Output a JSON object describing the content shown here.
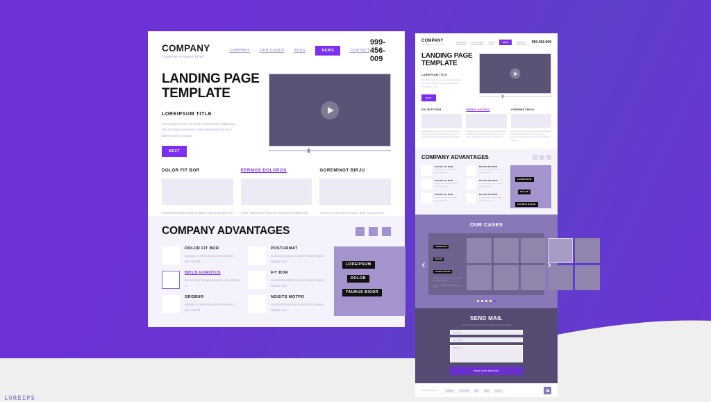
{
  "background": {
    "gradient_from": "#7030d8",
    "gradient_to": "#5f3ec9",
    "wave_color": "#efefef",
    "corner_text": "LOREIPS"
  },
  "brand": {
    "name": "COMPANY",
    "tagline": "TOURISM IPSUMUS FORS",
    "phone": "999-456-009"
  },
  "nav": {
    "items": [
      {
        "label": "COMPANY",
        "active": false
      },
      {
        "label": "OUR CASES",
        "active": false
      },
      {
        "label": "BLOG",
        "active": false
      },
      {
        "label": "NEWS",
        "active": true
      },
      {
        "label": "CONTACT",
        "active": false
      }
    ]
  },
  "hero": {
    "title": "LANDING PAGE TEMPLATE",
    "subtitle": "LOREIPSUM TITLE",
    "body": "Lorem ipsum dolor sit amet, consectetuer adipiscing elit, sed diam nonummy nibh euismod tincidunt ut laoreet dolore magna",
    "button": "NEXT",
    "video": {
      "play_icon": "play-icon",
      "progress_percent": 32
    }
  },
  "columns": [
    {
      "title": "DOLOR FIT BOR",
      "is_link": false,
      "text": "euismod tincidunt ut laoreet dolore magna aliquam erat volutpat. Ut wisi enim ad minim veniam, quis nostrud exerci tation ullamcorper suscipit lobortis nisl ut aliquip"
    },
    {
      "title": "PERMOS DOLOROS",
      "is_link": true,
      "text": "Lorem ipsum dolor sit amet, consectetuer adipiscing elit, sed diam nonummy nibh euismod tincidunt ut laoreet dolore magna aliquam erat volutpat. Ut wisi enim ad"
    },
    {
      "title": "GOREMINOT BIRJU",
      "is_link": false,
      "text": "Ut wisi enim ad minim veniam, quis nostrud exerci tation ullamcorper suscipit lobortis nisl ut aliquip ex ea commodo consequat. Duis autem vel eum iriure dolor in hendrerit"
    }
  ],
  "advantages": {
    "title": "COMPANY ADVANTAGES",
    "squares": 3,
    "left_items": [
      {
        "title": "DOLOR FIT BOR",
        "is_link": false,
        "text": "volutpat. Ut wisi enim ad minim veniam, quis nostrud"
      },
      {
        "title": "BITUS GOROTUS",
        "is_link": true,
        "text": "laoreet dolore magna aliquam erat volutpat. Ut"
      },
      {
        "title": "GROBUR",
        "is_link": false,
        "text": "volutpat. Ut wisi enim ad minim veniam, quis nostrud"
      }
    ],
    "right_items": [
      {
        "title": "POSTURMAT",
        "is_link": false,
        "text": "euismod tincidunt ut laoreet dolore magna aliquam erat"
      },
      {
        "title": "FIT BOR",
        "is_link": false,
        "text": "euismod tincidunt ut laoreet dolore magna aliquam erat"
      },
      {
        "title": "NOGITS MOTPO",
        "is_link": false,
        "text": "euismod tincidunt ut laoreet dolore magna aliquam erat"
      }
    ],
    "promo": {
      "line1": "LOREIPSUM",
      "line2": "DOLOR",
      "line3": "TAURUS BIGOR"
    }
  },
  "preview": {
    "advantage_item_title": "DOLOR FIT BOR",
    "advantage_item_text": "euismod tincidunt ut laoreet dolore magna aliquam erat",
    "cases": {
      "title": "OUR CASES",
      "prev_icon": "chevron-left-icon",
      "next_icon": "chevron-right-icon",
      "info": {
        "line1": "LOREIPSUM",
        "line2": "DOLOR",
        "line3": "TAURUS BIGOR"
      },
      "info_text1": "sed diam nonummy nibh euismod tincidunt ut laoreet dolore magna",
      "info_text2": "aliquam erat volutpat. Ut wisi enim ad minim veniam",
      "thumbnails": 10,
      "active_thumbnail": 4,
      "dots": 5,
      "active_dot": 5
    },
    "mail": {
      "title": "SEND MAIL",
      "subtitle": "sed diam nonummy nibh euismod tincidunt ut laoreet dolore magna",
      "name_placeholder": "Your name",
      "email_placeholder": "Your e-mail",
      "message_placeholder": "Message",
      "submit": "SEND YOUR MESSAGE"
    },
    "footer": {
      "site": "www.company.com",
      "links": [
        "COMPANY",
        "OUR CASES",
        "BLOG",
        "NEWS",
        "CONTACT"
      ],
      "top_icon": "scroll-to-top-icon"
    }
  },
  "colors": {
    "accent": "#7b2ff2",
    "muted_purple": "#a593cd",
    "dark_slate": "#564b72"
  }
}
